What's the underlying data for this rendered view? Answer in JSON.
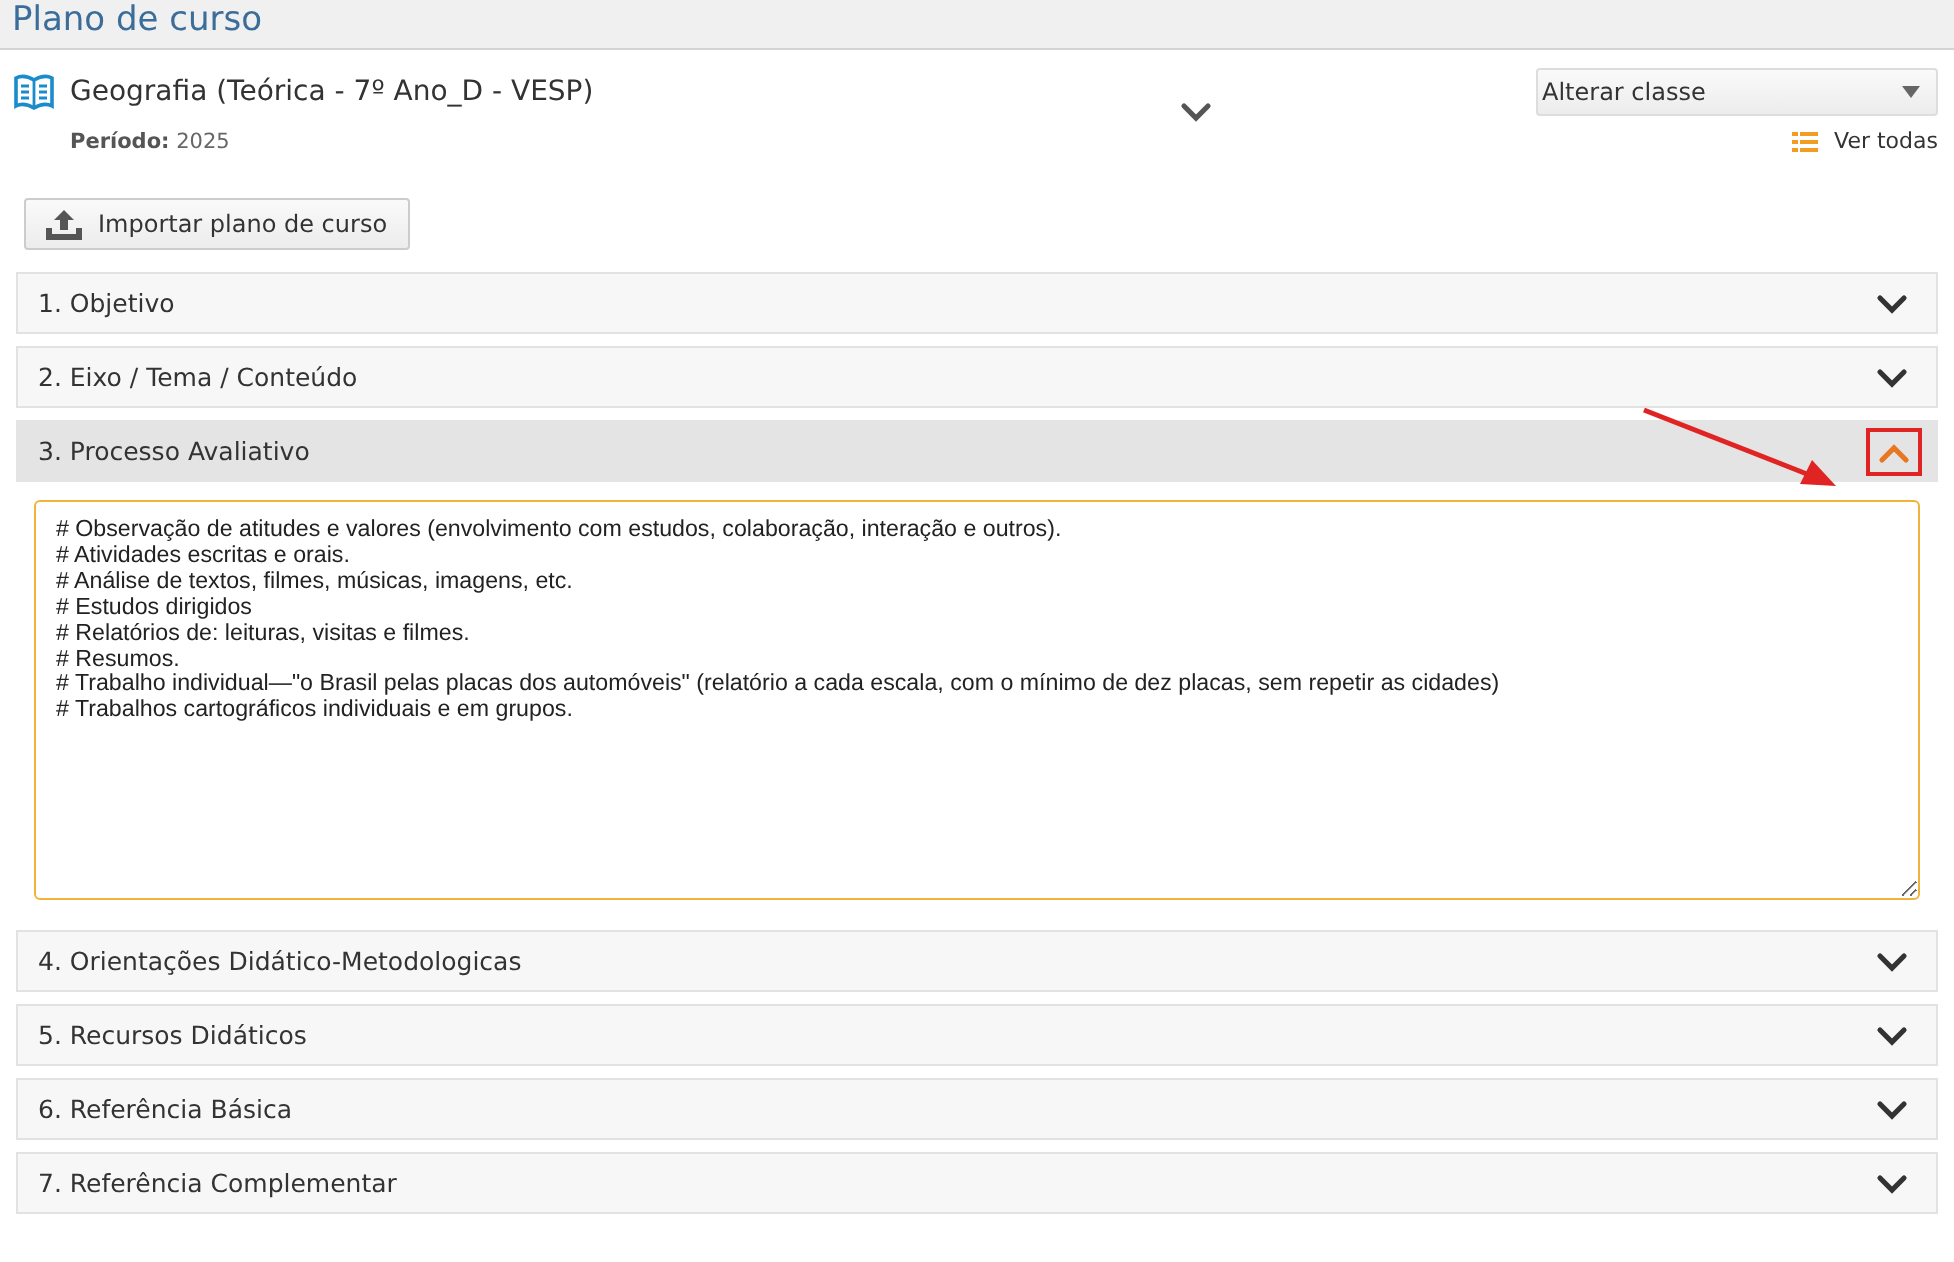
{
  "page_title": "Plano de curso",
  "course": {
    "title": "Geografia (Teórica - 7º Ano_D - VESP)",
    "period_label": "Período:",
    "period_value": "2025"
  },
  "class_select": {
    "value": "Alterar classe"
  },
  "see_all": "Ver todas",
  "import_button": "Importar plano de curso",
  "sections": [
    {
      "label": "1. Objetivo",
      "expanded": false
    },
    {
      "label": "2. Eixo / Tema / Conteúdo",
      "expanded": false
    },
    {
      "label": "3. Processo Avaliativo",
      "expanded": true,
      "highlighted": true,
      "content": [
        "# Observação de atitudes e valores (envolvimento com estudos, colaboração, interação e outros).",
        "# Atividades escritas e orais.",
        "# Análise de textos, filmes, músicas, imagens, etc.",
        "# Estudos dirigidos",
        "# Relatórios de: leituras, visitas e filmes.",
        "# Resumos.",
        "# Trabalho individual—\"o Brasil pelas placas dos automóveis\" (relatório a cada escala, com o mínimo de dez placas, sem repetir as cidades)",
        "# Trabalhos cartográficos individuais e em grupos."
      ]
    },
    {
      "label": "4. Orientações Didático-Metodologicas",
      "expanded": false
    },
    {
      "label": "5. Recursos Didáticos",
      "expanded": false
    },
    {
      "label": "6. Referência Básica",
      "expanded": false
    },
    {
      "label": "7. Referência Complementar",
      "expanded": false
    }
  ]
}
